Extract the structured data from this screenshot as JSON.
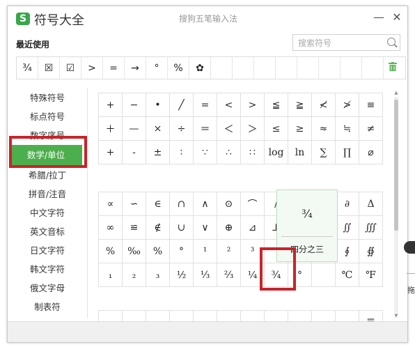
{
  "app": {
    "logo_text": "S",
    "title": "符号大全",
    "subtitle": "搜狗五笔输入法",
    "minimize": "—",
    "close": "✕"
  },
  "recent": {
    "label": "最近使用",
    "items": [
      "¾",
      "☒",
      "☑",
      ">",
      "=",
      "→",
      "°",
      "%",
      "✿",
      "",
      "",
      "",
      "",
      "",
      "",
      "",
      "",
      ""
    ]
  },
  "search": {
    "placeholder": "搜索符号"
  },
  "sidebar": {
    "items": [
      "特殊符号",
      "标点符号",
      "数字序号",
      "数学/单位",
      "希腊/拉丁",
      "拼音/注音",
      "中文字符",
      "英文音标",
      "日文字符",
      "韩文字符",
      "俄文字母",
      "制表符"
    ],
    "active_index": 3
  },
  "grid1": [
    [
      "+",
      "−",
      "•",
      "╱",
      "=",
      "<",
      ">",
      "≦",
      "≧",
      "≮",
      "≯",
      "≡"
    ],
    [
      "＋",
      "—",
      "×",
      "÷",
      "＝",
      "＜",
      "＞",
      "≤",
      "≥",
      "≈",
      "≒",
      "≠"
    ],
    [
      "+",
      "-",
      "±",
      "∶",
      "∵",
      "∴",
      "∷",
      "log",
      "ln",
      "∑",
      "∏",
      "⌀"
    ]
  ],
  "grid2": [
    [
      "∝",
      "∽",
      "∈",
      "∩",
      "∧",
      "⊙",
      "⌒",
      "∕",
      "",
      "",
      "∂",
      "Δ"
    ],
    [
      "∞",
      "≌",
      "∉",
      "∪",
      "∨",
      "⊕",
      "⊿",
      "⊥",
      "",
      "",
      "∬",
      "∭"
    ],
    [
      "%",
      "‰",
      "%",
      "°",
      "¹",
      "²",
      "³",
      "",
      "",
      "",
      "∮",
      "∯"
    ],
    [
      "₁",
      "₂",
      "₃",
      "½",
      "⅓",
      "⅔",
      "¼",
      "¾",
      "°",
      "",
      "℃",
      "℉"
    ]
  ],
  "grid2_extra": [
    "〒"
  ],
  "popup": {
    "symbol": "¾",
    "name": "四分之三"
  },
  "outside": {
    "text": "拖"
  },
  "colors": {
    "accent": "#4cae4c",
    "highlight": "#c8232a"
  }
}
